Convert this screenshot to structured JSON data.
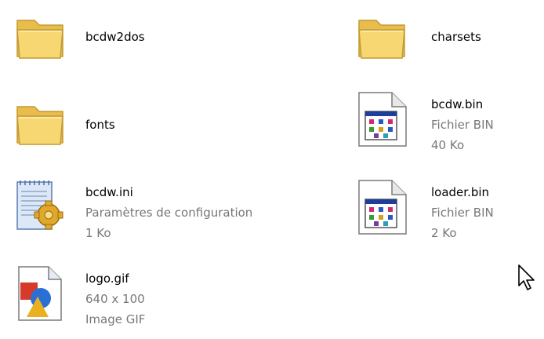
{
  "colors": {
    "folder_front": "#f6d36a",
    "folder_back": "#eabe4c",
    "folder_edge": "#c49a33",
    "file_text": "#000000",
    "file_subtext": "#777777"
  },
  "files": [
    {
      "name": "bcdw2dos",
      "icon": "folder-icon"
    },
    {
      "name": "charsets",
      "icon": "folder-icon"
    },
    {
      "name": "fonts",
      "icon": "folder-icon"
    },
    {
      "name": "bcdw.bin",
      "type": "Fichier BIN",
      "size": "40 Ko",
      "icon": "bin-file-icon"
    },
    {
      "name": "bcdw.ini",
      "type": "Paramètres de configuration",
      "size": "1 Ko",
      "icon": "config-file-icon"
    },
    {
      "name": "loader.bin",
      "type": "Fichier BIN",
      "size": "2 Ko",
      "icon": "bin-file-icon"
    },
    {
      "name": "logo.gif",
      "dimensions": "640 x 100",
      "type": "Image GIF",
      "icon": "gif-image-icon"
    }
  ]
}
